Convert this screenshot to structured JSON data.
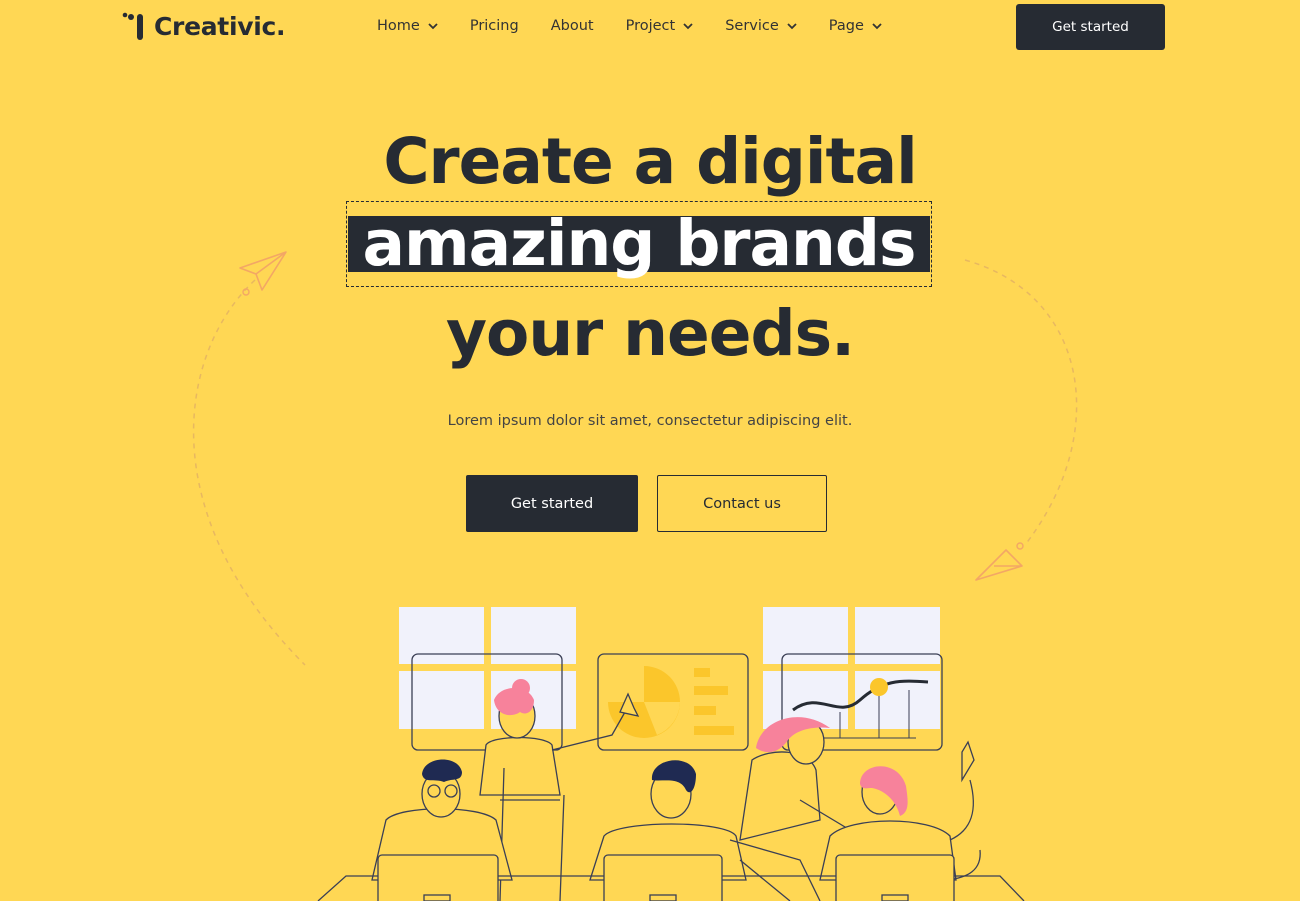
{
  "brand": {
    "name": "Creativic."
  },
  "nav": {
    "items": [
      {
        "label": "Home",
        "has_dropdown": true
      },
      {
        "label": "Pricing",
        "has_dropdown": false
      },
      {
        "label": "About",
        "has_dropdown": false
      },
      {
        "label": "Project",
        "has_dropdown": true
      },
      {
        "label": "Service",
        "has_dropdown": true
      },
      {
        "label": "Page",
        "has_dropdown": true
      }
    ],
    "cta_label": "Get started"
  },
  "hero": {
    "line1": "Create a digital",
    "line2": "amazing brands",
    "line3": "your needs.",
    "subtitle": "Lorem ipsum dolor sit amet, consectetur adipiscing elit.",
    "primary_label": "Get started",
    "secondary_label": "Contact us"
  },
  "icons": {
    "chevron": "chevron-down-icon",
    "paper_plane": "paper-plane-icon"
  },
  "colors": {
    "background": "#ffd754",
    "dark": "#262b33",
    "pink": "#f7829b",
    "window": "#f1f2fb"
  }
}
